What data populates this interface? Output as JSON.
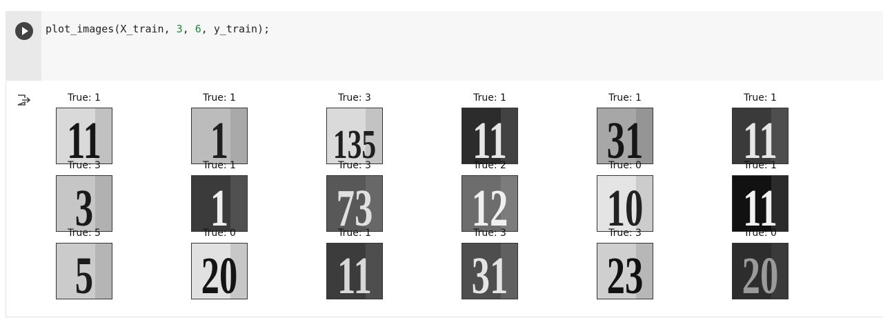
{
  "cell": {
    "code_parts": [
      {
        "text": "plot_images(X_train, ",
        "kind": "plain"
      },
      {
        "text": "3",
        "kind": "num"
      },
      {
        "text": ", ",
        "kind": "plain"
      },
      {
        "text": "6",
        "kind": "num"
      },
      {
        "text": ", y_train);",
        "kind": "plain"
      }
    ]
  },
  "icons": {
    "run": "play-icon",
    "output": "output-arrow-icon"
  },
  "images": [
    {
      "title": "True: 1",
      "digits": "11",
      "bg": "#d9d9d9",
      "fg": "#161616"
    },
    {
      "title": "True: 1",
      "digits": "1",
      "bg": "#bcbcbc",
      "fg": "#202020"
    },
    {
      "title": "True: 3",
      "digits": "135",
      "bg": "#dadada",
      "fg": "#1f1f1f"
    },
    {
      "title": "True: 1",
      "digits": "11",
      "bg": "#2c2c2c",
      "fg": "#e6e6e6"
    },
    {
      "title": "True: 1",
      "digits": "31",
      "bg": "#a7a7a7",
      "fg": "#161616"
    },
    {
      "title": "True: 1",
      "digits": "11",
      "bg": "#3a3a3a",
      "fg": "#e6e6e6"
    },
    {
      "title": "True: 3",
      "digits": "3",
      "bg": "#c6c6c6",
      "fg": "#1a1a1a"
    },
    {
      "title": "True: 1",
      "digits": "1",
      "bg": "#3b3b3b",
      "fg": "#efefef"
    },
    {
      "title": "True: 3",
      "digits": "73",
      "bg": "#585858",
      "fg": "#e0e0e0"
    },
    {
      "title": "True: 2",
      "digits": "12",
      "bg": "#6d6d6d",
      "fg": "#f0f0f0"
    },
    {
      "title": "True: 0",
      "digits": "10",
      "bg": "#e4e4e4",
      "fg": "#222222"
    },
    {
      "title": "True: 1",
      "digits": "11",
      "bg": "#111111",
      "fg": "#f2f2f2"
    },
    {
      "title": "True: 5",
      "digits": "5",
      "bg": "#cbcbcb",
      "fg": "#1c1c1c"
    },
    {
      "title": "True: 0",
      "digits": "20",
      "bg": "#e1e1e1",
      "fg": "#141414"
    },
    {
      "title": "True: 1",
      "digits": "11",
      "bg": "#3c3c3c",
      "fg": "#d8d8d8"
    },
    {
      "title": "True: 3",
      "digits": "31",
      "bg": "#4e4e4e",
      "fg": "#e4e4e4"
    },
    {
      "title": "True: 3",
      "digits": "23",
      "bg": "#cfcfcf",
      "fg": "#111111"
    },
    {
      "title": "True: 0",
      "digits": "20",
      "bg": "#2d2d2d",
      "fg": "#9a9a9a"
    }
  ]
}
